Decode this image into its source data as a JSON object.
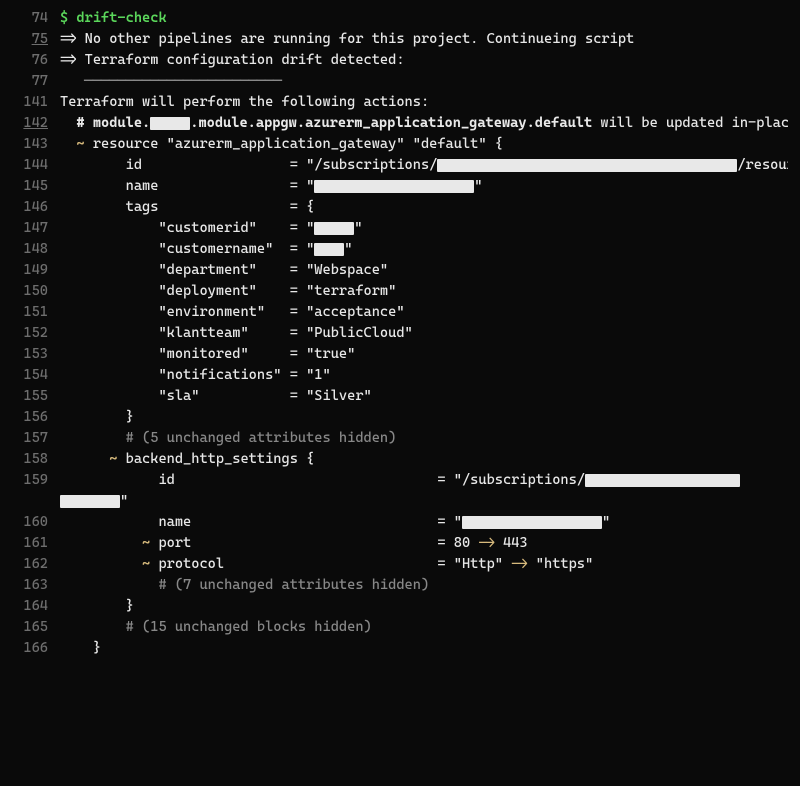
{
  "lines": {
    "l74_no": "74",
    "l74_prompt": "$ ",
    "l74_cmd": "drift-check",
    "l75_no": "75",
    "l75_text": "=> No other pipelines are running for this project. Continueing script",
    "l76_no": "76",
    "l76_text": "=> Terraform configuration drift detected:",
    "l77_no": "77",
    "l77_text": "   ────────────────────────",
    "l141_no": "141",
    "l141_text": "Terraform will perform the following actions:",
    "l142_no": "142",
    "l142_a": "  # module.",
    "l142_b": ".module.appgw.azurerm_application_gateway.default",
    "l142_c": " will be updated in-place",
    "l143_no": "143",
    "l143_a": "  ~ ",
    "l143_b": "resource \"azurerm_application_gateway\" \"default\" {",
    "l144_no": "144",
    "l144_a": "        id                  = \"/subscriptions/",
    "l144_b": "/resour",
    "l145_no": "145",
    "l145_a": "        name                = \"",
    "l145_b": "\"",
    "l146_no": "146",
    "l146_text": "        tags                = {",
    "l147_no": "147",
    "l147_a": "            \"customerid\"    = \"",
    "l147_b": "\"",
    "l148_no": "148",
    "l148_a": "            \"customername\"  = \"",
    "l148_b": "\"",
    "l149_no": "149",
    "l149_text": "            \"department\"    = \"Webspace\"",
    "l150_no": "150",
    "l150_text": "            \"deployment\"    = \"terraform\"",
    "l151_no": "151",
    "l151_text": "            \"environment\"   = \"acceptance\"",
    "l152_no": "152",
    "l152_text": "            \"klantteam\"     = \"PublicCloud\"",
    "l153_no": "153",
    "l153_text": "            \"monitored\"     = \"true\"",
    "l154_no": "154",
    "l154_text": "            \"notifications\" = \"1\"",
    "l155_no": "155",
    "l155_text": "            \"sla\"           = \"Silver\"",
    "l156_no": "156",
    "l156_text": "        }",
    "l157_no": "157",
    "l157_text": "        # (5 unchanged attributes hidden)",
    "l158_no": "158",
    "l158_a": "      ~ ",
    "l158_b": "backend_http_settings {",
    "l159_no": "159",
    "l159_a": "            id                                = \"/subscriptions/",
    "l159b_text": "\"",
    "l160_no": "160",
    "l160_a": "            name                              = \"",
    "l160_b": "\"",
    "l161_no": "161",
    "l161_a": "          ~ ",
    "l161_b": "port                              = ",
    "l161_c": "80",
    "l161_d": " -> ",
    "l161_e": "443",
    "l162_no": "162",
    "l162_a": "          ~ ",
    "l162_b": "protocol                          = ",
    "l162_c": "\"Http\"",
    "l162_d": " -> ",
    "l162_e": "\"https\"",
    "l163_no": "163",
    "l163_text": "            # (7 unchanged attributes hidden)",
    "l164_no": "164",
    "l164_text": "        }",
    "l165_no": "165",
    "l165_text": "        # (15 unchanged blocks hidden)",
    "l166_no": "166",
    "l166_text": "    }"
  }
}
